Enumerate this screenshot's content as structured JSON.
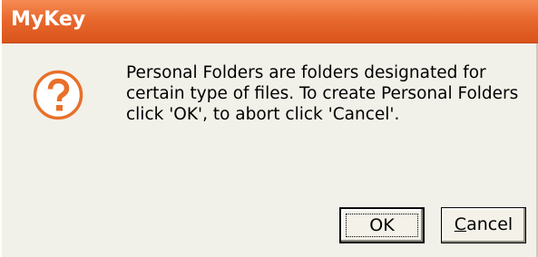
{
  "window": {
    "title": "MyKey"
  },
  "dialog": {
    "icon": "question-icon",
    "message_lines": [
      "Personal Folders are folders designated for",
      "certain type of files. To create Personal Folders",
      "click 'OK', to abort click 'Cancel'."
    ]
  },
  "buttons": {
    "ok_label": "OK",
    "cancel_mnemonic": "C",
    "cancel_rest": "ancel"
  },
  "colors": {
    "titlebar": "#e8692e",
    "icon_orange": "#e8702a",
    "dialog_bg": "#f2f1e9"
  }
}
